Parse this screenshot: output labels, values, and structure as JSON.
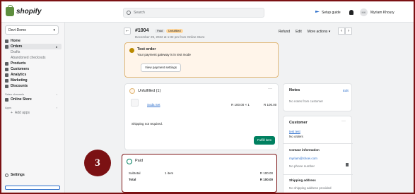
{
  "topbar": {
    "logo_text": "shopify",
    "search_placeholder": "Search",
    "setup_label": "Setup guide",
    "avatar_initials": "MK",
    "user_name": "Myriam Khoury"
  },
  "sidebar": {
    "store_name": "Devi-Demo",
    "items": [
      {
        "label": "Home",
        "count": ""
      },
      {
        "label": "Orders",
        "count": "3"
      },
      {
        "label": "Drafts",
        "count": ""
      },
      {
        "label": "Abandoned checkouts",
        "count": ""
      },
      {
        "label": "Products",
        "count": ""
      },
      {
        "label": "Customers",
        "count": ""
      },
      {
        "label": "Analytics",
        "count": ""
      },
      {
        "label": "Marketing",
        "count": ""
      },
      {
        "label": "Discounts",
        "count": ""
      }
    ],
    "sales_channels_label": "Sales channels",
    "online_store_label": "Online Store",
    "apps_label": "Apps",
    "add_apps_label": "Add apps",
    "settings_label": "Settings"
  },
  "header": {
    "order_number": "#1004",
    "badge_paid": "Paid",
    "badge_unfulfilled": "Unfulfilled",
    "date": "December 29, 2022 at 1:32 pm from Online Store",
    "refund": "Refund",
    "edit": "Edit",
    "more_actions": "More actions"
  },
  "test_order": {
    "title": "Test order",
    "desc": "Your payment gateway is in test mode",
    "button": "View payment settings"
  },
  "unfulfilled": {
    "title": "Unfulfilled (1)",
    "product_name": "Soda Set",
    "qty": "R 100.00 × 1",
    "total": "R 100.00",
    "shipping_note": "Shipping not required.",
    "fulfill_button": "Fulfill item"
  },
  "paid": {
    "title": "Paid",
    "subtotal_label": "Subtotal",
    "subtotal_items": "1 item",
    "subtotal_value": "R 100.00",
    "total_label": "Total",
    "total_value": "R 100.00"
  },
  "notes": {
    "title": "Notes",
    "edit": "Edit",
    "text": "No notes from customer"
  },
  "customer": {
    "title": "Customer",
    "name": "test test",
    "orders": "No orders",
    "contact_title": "Contact information",
    "email": "myriam@shoei.com",
    "phone": "No phone number",
    "shipping_title": "Shipping address",
    "shipping_text": "No shipping address provided"
  },
  "marker": {
    "step": "3"
  },
  "colors": {
    "marker": "#7b1113",
    "primary_button": "#008060",
    "link": "#2c6ecb"
  }
}
